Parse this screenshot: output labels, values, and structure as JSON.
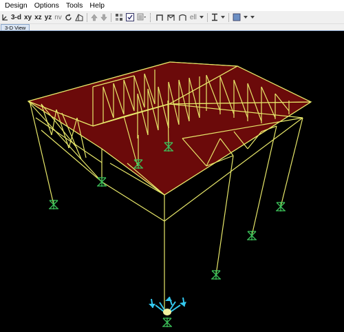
{
  "menu": [
    "Design",
    "Options",
    "Tools",
    "Help"
  ],
  "toolbar": {
    "view_3d": "3-d",
    "view_xy": "xy",
    "view_xz": "xz",
    "view_yz": "yz",
    "view_nv": "nv",
    "view_label": "ell"
  },
  "tabs": [
    "3-D View"
  ],
  "colors": {
    "roof_fill": "#6b0a0a",
    "frame": "#e8e86a",
    "support": "#3cc25a",
    "load_arrows": "#33c8ee",
    "background": "#000000"
  }
}
